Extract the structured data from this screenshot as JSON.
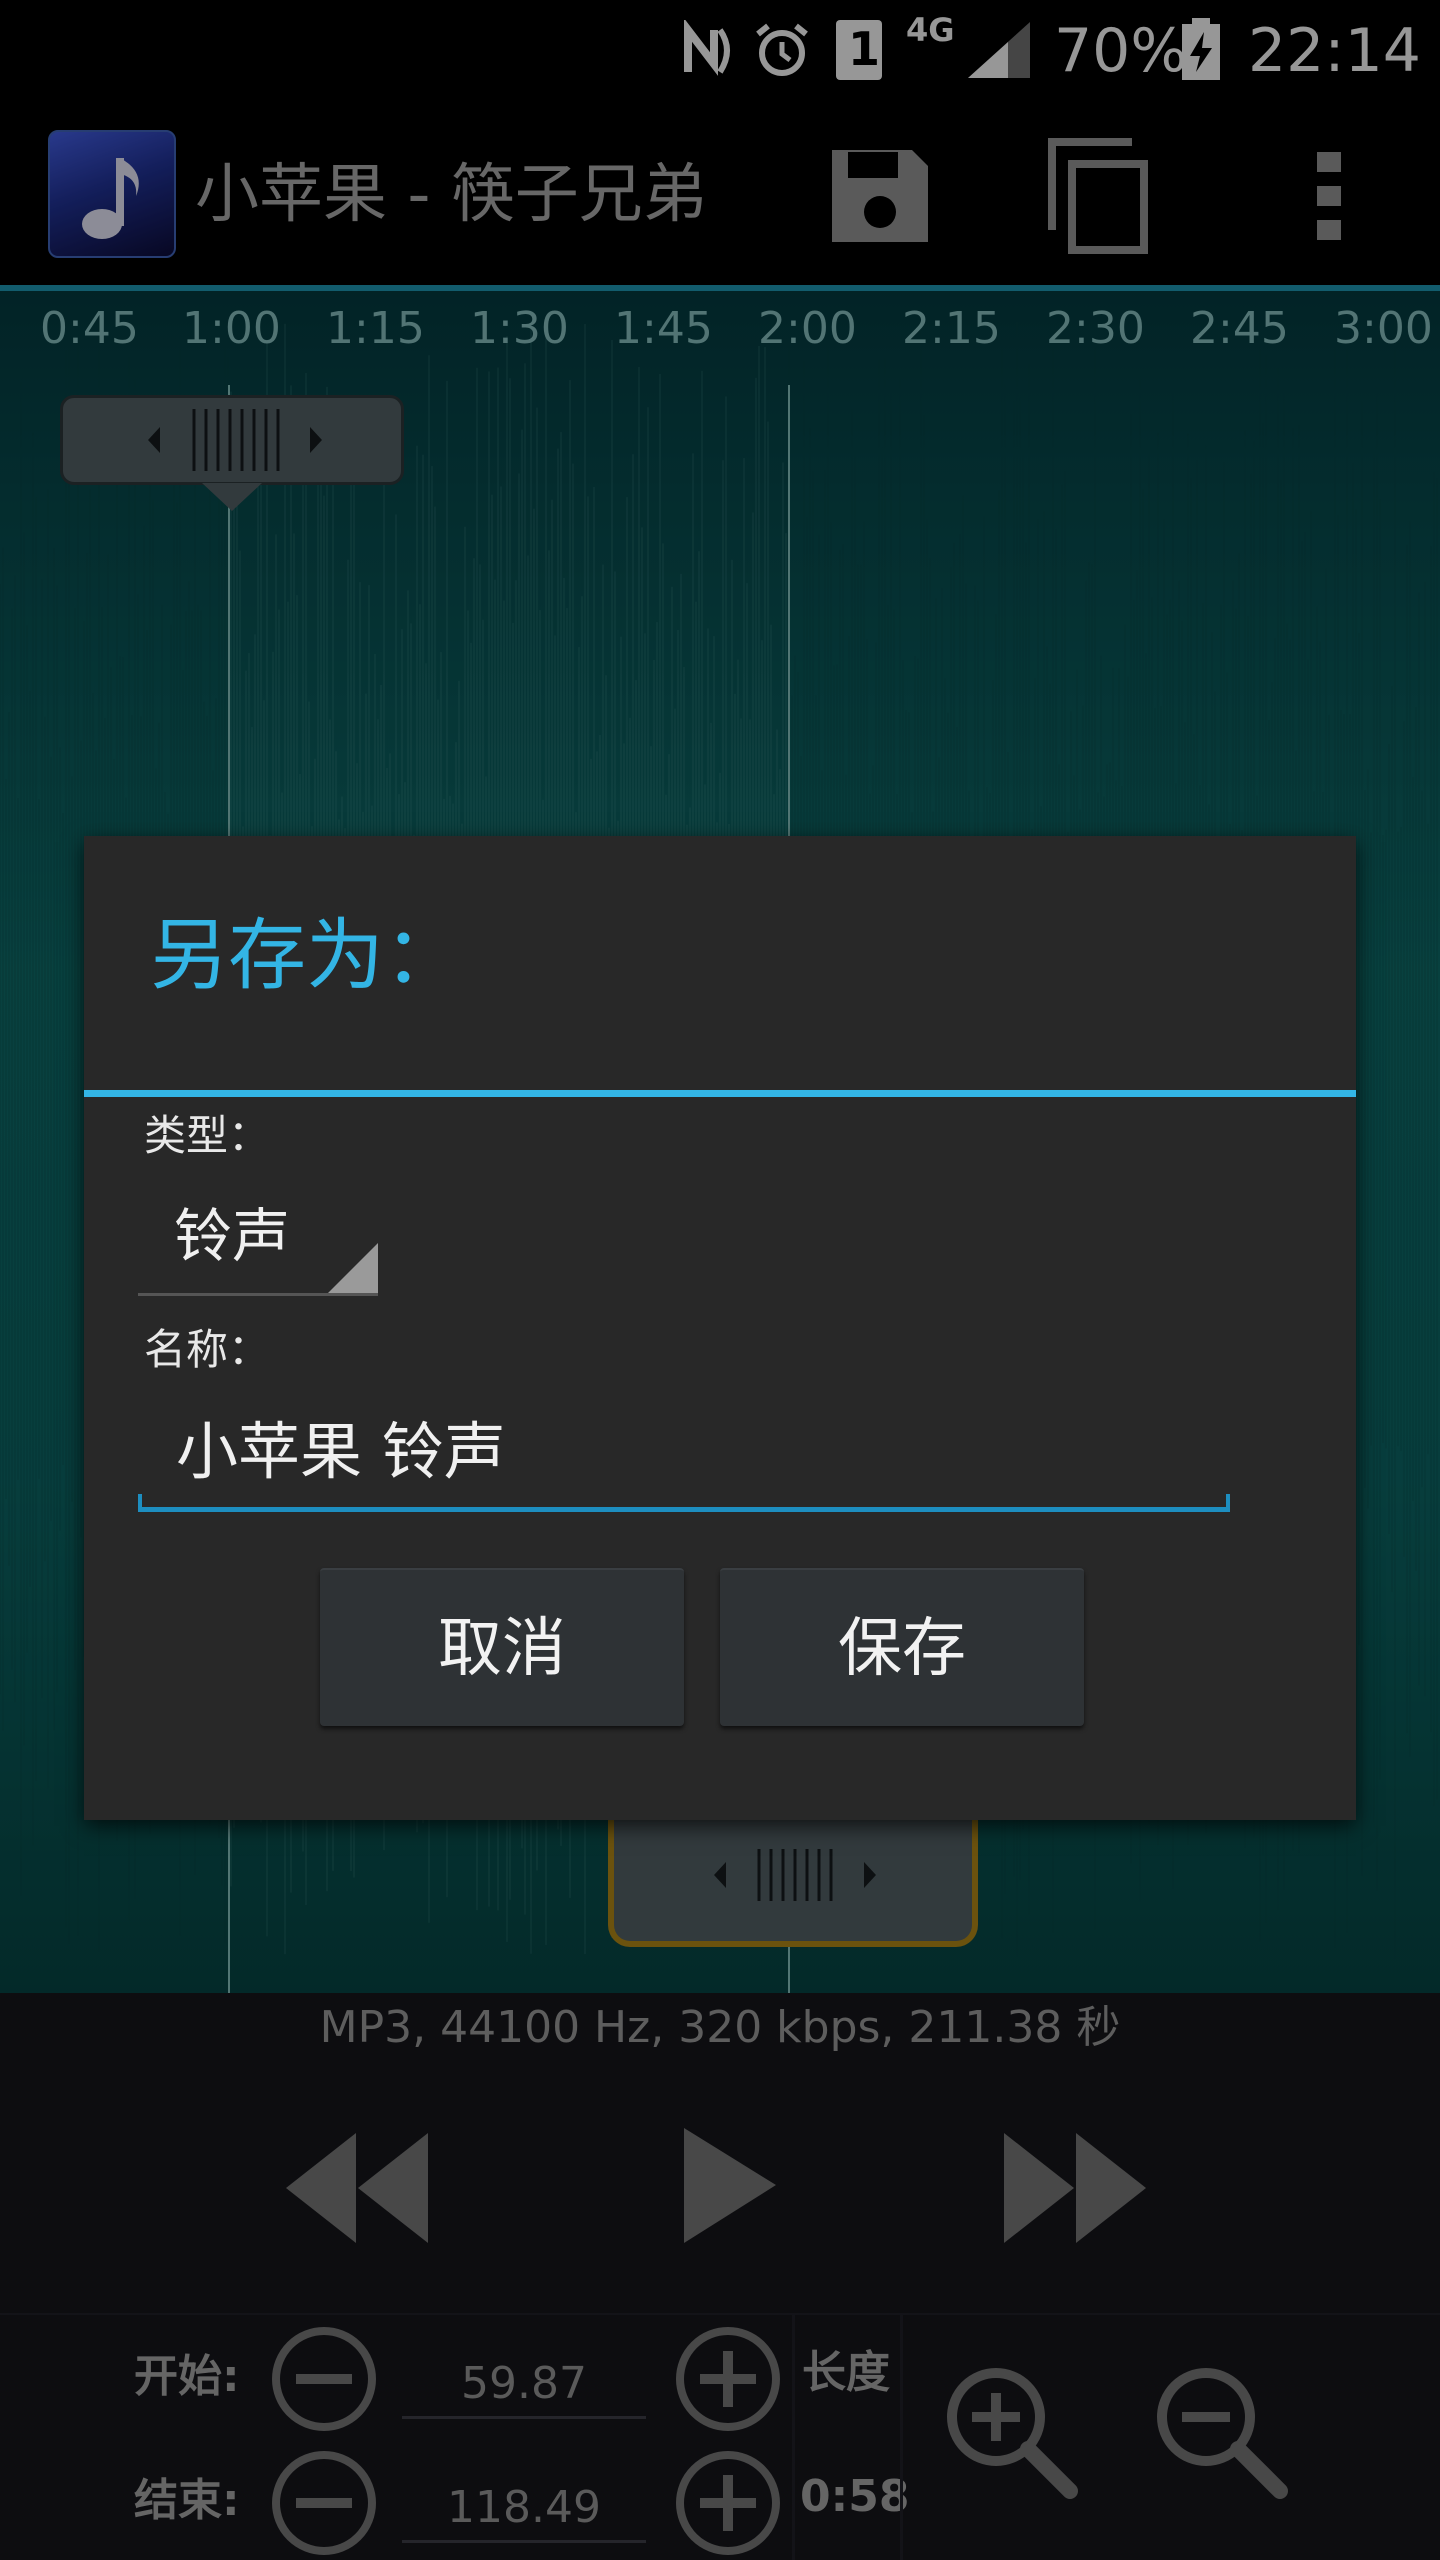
{
  "status_bar": {
    "battery": "70%",
    "time": "22:14",
    "network": "4G",
    "sim": "1"
  },
  "action_bar": {
    "title": "小苹果 - 筷子兄弟",
    "icons": [
      "music-note-icon",
      "save-icon",
      "copy-icon",
      "more-icon"
    ]
  },
  "timeline": {
    "ticks": [
      "0:45",
      "1:00",
      "1:15",
      "1:30",
      "1:45",
      "2:00",
      "2:15",
      "2:30",
      "2:45",
      "3:00"
    ]
  },
  "audio_info": "MP3, 44100 Hz, 320 kbps, 211.38 秒",
  "controls": {
    "start_label": "开始:",
    "end_label": "结束:",
    "start_value": "59.87",
    "end_value": "118.49",
    "length_label": "长度",
    "length_value": "0:58"
  },
  "dialog": {
    "title": "另存为：",
    "type_label": "类型：",
    "type_value": "铃声",
    "name_label": "名称：",
    "name_value": "小苹果 铃声",
    "cancel_label": "取消",
    "save_label": "保存"
  },
  "colors": {
    "accent": "#33b5e5",
    "waveform": "#0b5f5e",
    "handle_border": "#a57e16"
  }
}
